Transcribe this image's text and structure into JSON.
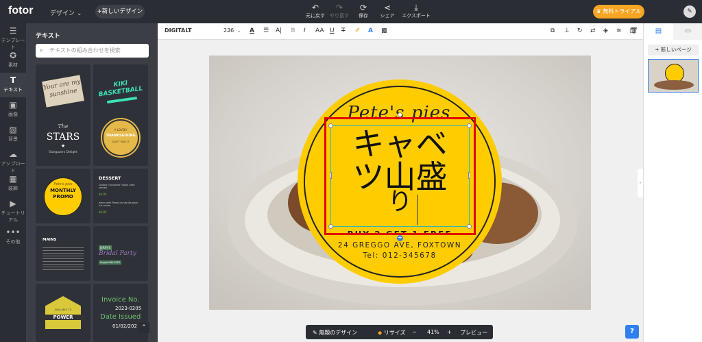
{
  "topbar": {
    "logo": "fotor",
    "design_menu": "デザイン",
    "new_design": "+新しいデザイン",
    "undo": "元に戻す",
    "redo": "やり直す",
    "save": "保存",
    "share": "シェア",
    "export": "エクスポート",
    "trial": "無料トライアル"
  },
  "nav": {
    "items": [
      {
        "label": "テンプレート",
        "icon": "layers-icon"
      },
      {
        "label": "素材",
        "icon": "elements-icon"
      },
      {
        "label": "テキスト",
        "icon": "text-icon"
      },
      {
        "label": "画像",
        "icon": "image-icon"
      },
      {
        "label": "背景",
        "icon": "background-icon"
      },
      {
        "label": "アップロード",
        "icon": "upload-icon"
      },
      {
        "label": "装飾",
        "icon": "decoration-icon"
      },
      {
        "label": "チュートリアル",
        "icon": "tutorial-icon"
      },
      {
        "label": "その他",
        "icon": "more-icon"
      }
    ]
  },
  "panel": {
    "title": "テキスト",
    "search_placeholder": "テキストの組み合わせを検索",
    "cards": {
      "c1": "Your are my sunshine",
      "c2a": "KIKI",
      "c2b": "BASKETBALL",
      "c3a": "The",
      "c3b": "STARS",
      "c3c": "Stargazers Delight",
      "c4a": "A LOVELY",
      "c4b": "THANKSGIVING",
      "c4c": "DON'T MISS IT",
      "c5a": "Pete's pies",
      "c5b": "MONTHLY",
      "c5c": "PROMO",
      "c6a": "DESSERT",
      "c6b": "Double Chocolate Fudge Cake served",
      "c6c": "$9.00",
      "c6d": "warm with Premium Vanilla bean ice cream",
      "c6e": "$6.00",
      "c7a": "MAINS",
      "c8a": "JERRY'S",
      "c8b": "Bridal Party",
      "c8c": "August 8th 2022",
      "c9a": "AVAILABLE TO",
      "c9b": "POWER",
      "c10a": "Invoice No.",
      "c10b": "2023-0205",
      "c10c": "Date Issued",
      "c10d": "01/02/202"
    }
  },
  "toolbar": {
    "font": "DIGITALT",
    "size": "236"
  },
  "design": {
    "script_text": "Pete's pies",
    "main_text_line1": "キャベ",
    "main_text_line2": "ツ山盛",
    "main_text_line3": "り",
    "buy_text": "BUY 2 GET 1 FREE",
    "address": "24 GREGGO AVE, FOXTOWN",
    "tel": "Tel: 012-345678"
  },
  "right_panel": {
    "add_page": "+ 新しいページ"
  },
  "bottom": {
    "design_name": "無題のデザイン",
    "resize": "リサイズ",
    "zoom": "41%",
    "preview": "プレビュー"
  },
  "colors": {
    "accent": "#2f80ed",
    "badge_yellow": "#ffcc00",
    "dark": "#2a2d33",
    "selection_red": "#e00000",
    "trial_orange": "#f6a623"
  }
}
